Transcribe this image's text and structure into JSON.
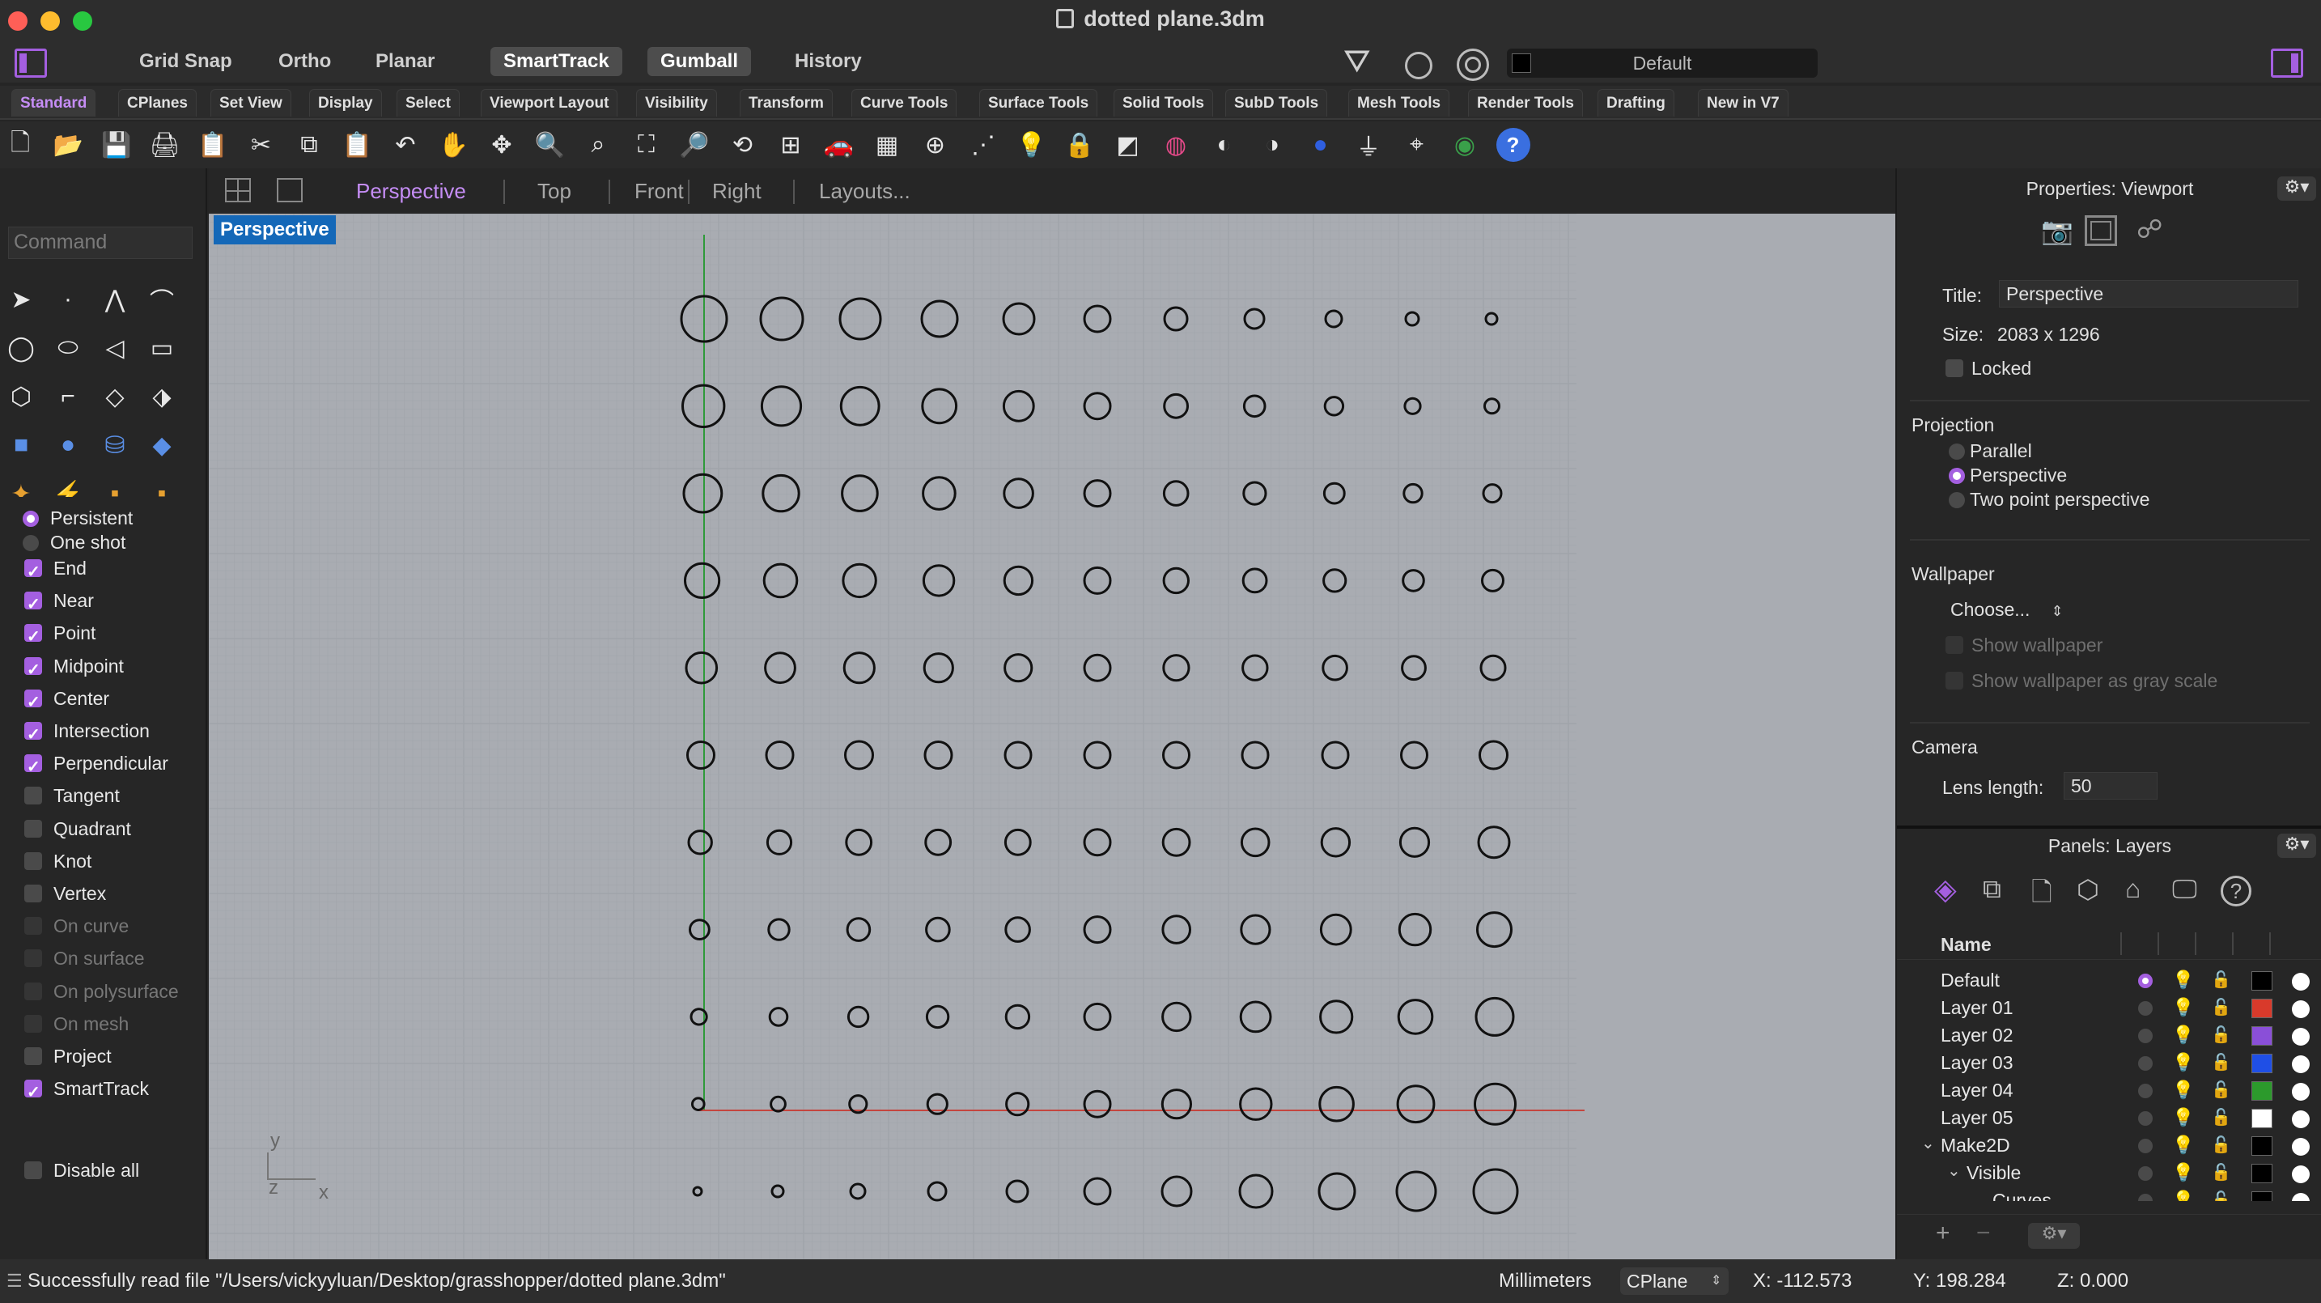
{
  "window": {
    "title": "dotted plane.3dm"
  },
  "statusbar_top": {
    "toggles": [
      {
        "label": "Grid Snap",
        "on": false
      },
      {
        "label": "Ortho",
        "on": false
      },
      {
        "label": "Planar",
        "on": false
      },
      {
        "label": "SmartTrack",
        "on": true
      },
      {
        "label": "Gumball",
        "on": true
      },
      {
        "label": "History",
        "on": false
      }
    ],
    "current_layer": "Default"
  },
  "tabs": [
    "Standard",
    "CPlanes",
    "Set View",
    "Display",
    "Select",
    "Viewport Layout",
    "Visibility",
    "Transform",
    "Curve Tools",
    "Surface Tools",
    "Solid Tools",
    "SubD Tools",
    "Mesh Tools",
    "Render Tools",
    "Drafting",
    "New in V7"
  ],
  "active_tab": "Standard",
  "toolbar_icons": [
    "new-file-icon",
    "open-file-icon",
    "save-icon",
    "print-icon",
    "import-icon",
    "cut-icon",
    "copy-icon",
    "paste-icon",
    "undo-icon",
    "pan-hand-icon",
    "rotate-view-icon",
    "zoom-icon",
    "zoom-window-icon",
    "zoom-extents-icon",
    "zoom-selected-icon",
    "undo-view-icon",
    "four-viewports-icon",
    "car-render-icon",
    "grid-icon",
    "cplane-icon",
    "points-icon",
    "lights-icon",
    "lock-icon",
    "material-icon",
    "color-wheel-icon",
    "shaded-sphere-icon",
    "render-sphere-icon",
    "blue-sphere-icon",
    "filter-icon",
    "gumball-icon",
    "globe-icon",
    "help-icon"
  ],
  "command": {
    "placeholder": "Command"
  },
  "osnap": {
    "mode": [
      {
        "label": "Persistent",
        "selected": true
      },
      {
        "label": "One shot",
        "selected": false
      }
    ],
    "items": [
      {
        "label": "End",
        "checked": true,
        "enabled": true
      },
      {
        "label": "Near",
        "checked": true,
        "enabled": true
      },
      {
        "label": "Point",
        "checked": true,
        "enabled": true
      },
      {
        "label": "Midpoint",
        "checked": true,
        "enabled": true
      },
      {
        "label": "Center",
        "checked": true,
        "enabled": true
      },
      {
        "label": "Intersection",
        "checked": true,
        "enabled": true
      },
      {
        "label": "Perpendicular",
        "checked": true,
        "enabled": true
      },
      {
        "label": "Tangent",
        "checked": false,
        "enabled": true
      },
      {
        "label": "Quadrant",
        "checked": false,
        "enabled": true
      },
      {
        "label": "Knot",
        "checked": false,
        "enabled": true
      },
      {
        "label": "Vertex",
        "checked": false,
        "enabled": true
      },
      {
        "label": "On curve",
        "checked": false,
        "enabled": false
      },
      {
        "label": "On surface",
        "checked": false,
        "enabled": false
      },
      {
        "label": "On polysurface",
        "checked": false,
        "enabled": false
      },
      {
        "label": "On mesh",
        "checked": false,
        "enabled": false
      },
      {
        "label": "Project",
        "checked": false,
        "enabled": true
      },
      {
        "label": "SmartTrack",
        "checked": true,
        "enabled": true
      }
    ],
    "disable_all": "Disable all"
  },
  "viewport_tabs": [
    "Perspective",
    "Top",
    "Front",
    "Right",
    "Layouts..."
  ],
  "active_viewport_tab": "Perspective",
  "viewport": {
    "label": "Perspective",
    "axis_labels": {
      "y": "y",
      "z": "z",
      "x": "x"
    }
  },
  "properties": {
    "header": "Properties: Viewport",
    "title_label": "Title:",
    "title_value": "Perspective",
    "size_label": "Size:",
    "size_value": "2083 x 1296",
    "locked_label": "Locked",
    "projection_header": "Projection",
    "projections": [
      {
        "label": "Parallel",
        "selected": false
      },
      {
        "label": "Perspective",
        "selected": true
      },
      {
        "label": "Two point perspective",
        "selected": false
      }
    ],
    "wallpaper_header": "Wallpaper",
    "wallpaper_choose": "Choose...",
    "show_wallpaper": "Show wallpaper",
    "show_gray": "Show wallpaper as gray scale",
    "camera_header": "Camera",
    "lens_label": "Lens length:",
    "lens_value": "50"
  },
  "layers": {
    "header": "Panels: Layers",
    "name_col": "Name",
    "rows": [
      {
        "name": "Default",
        "current": true,
        "color": "#000000",
        "indent": 0
      },
      {
        "name": "Layer 01",
        "current": false,
        "color": "#d93a2b",
        "indent": 0
      },
      {
        "name": "Layer 02",
        "current": false,
        "color": "#8a4fd8",
        "indent": 0
      },
      {
        "name": "Layer 03",
        "current": false,
        "color": "#1f4fe6",
        "indent": 0
      },
      {
        "name": "Layer 04",
        "current": false,
        "color": "#2c9a2c",
        "indent": 0
      },
      {
        "name": "Layer 05",
        "current": false,
        "color": "#ffffff",
        "indent": 0
      },
      {
        "name": "Make2D",
        "current": false,
        "color": "#000000",
        "indent": 0,
        "expanded": true
      },
      {
        "name": "Visible",
        "current": false,
        "color": "#000000",
        "indent": 1,
        "expanded": true
      },
      {
        "name": "Curves",
        "current": false,
        "color": "#000000",
        "indent": 2
      }
    ]
  },
  "status": {
    "message": "Successfully read file \"/Users/vickyyluan/Desktop/grasshopper/dotted plane.3dm\"",
    "units": "Millimeters",
    "cplane": "CPlane",
    "x": "X: -112.573",
    "y": "Y: 198.284",
    "z": "Z: 0.000"
  },
  "colors": {
    "accent": "#a45fe0",
    "viewport_bg": "#a9adb3",
    "x_axis": "#c4463f",
    "y_axis": "#2f9a3a"
  }
}
